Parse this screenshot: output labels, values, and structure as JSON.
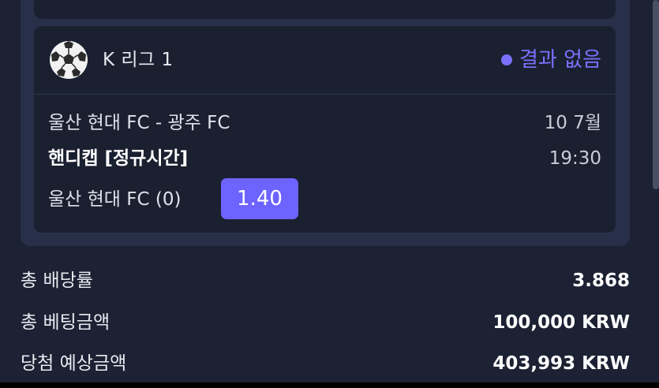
{
  "bet": {
    "league": "K 리그 1",
    "status": "결과 없음",
    "match": "울산 현대 FC - 광주 FC",
    "date": "10 7월",
    "market": "핸디캡 [정규시간]",
    "time": "19:30",
    "selection": "울산 현대 FC (0)",
    "odds": "1.40",
    "league_icon": "soccer-ball-icon"
  },
  "summary": {
    "total_odds_label": "총 배당률",
    "total_odds_value": "3.868",
    "total_stake_label": "총 베팅금액",
    "total_stake_value": "100,000 KRW",
    "potential_win_label": "당첨 예상금액",
    "potential_win_value": "403,993 KRW"
  },
  "colors": {
    "background": "#1c2133",
    "card": "#1b2031",
    "outer_card": "#283049",
    "accent": "#6d63ff",
    "status": "#7b71ff"
  }
}
